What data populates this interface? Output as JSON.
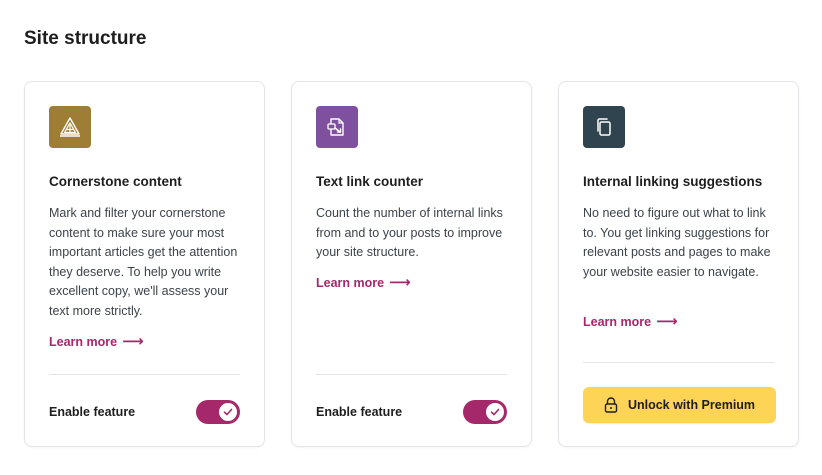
{
  "page": {
    "title": "Site structure"
  },
  "colors": {
    "accent": "#a4286a",
    "cornerstone_icon_bg": "#9e7e35",
    "text_link_icon_bg": "#7f509d",
    "internal_linking_icon_bg": "#30444f",
    "premium_button_bg": "#fdd455"
  },
  "cards": [
    {
      "icon": "pyramid-icon",
      "title": "Cornerstone content",
      "description": "Mark and filter your cornerstone content to make sure your most important articles get the attention they deserve. To help you write excellent copy, we'll assess your text more strictly.",
      "learn_more": "Learn more",
      "toggle_label": "Enable feature",
      "enabled": true
    },
    {
      "icon": "link-document-icon",
      "title": "Text link counter",
      "description": "Count the number of internal links from and to your posts to improve your site structure.",
      "learn_more": "Learn more",
      "toggle_label": "Enable feature",
      "enabled": true
    },
    {
      "icon": "copy-documents-icon",
      "title": "Internal linking suggestions",
      "description": "No need to figure out what to link to. You get linking suggestions for relevant posts and pages to make your website easier to navigate.",
      "learn_more": "Learn more",
      "premium_button": "Unlock with Premium"
    }
  ]
}
